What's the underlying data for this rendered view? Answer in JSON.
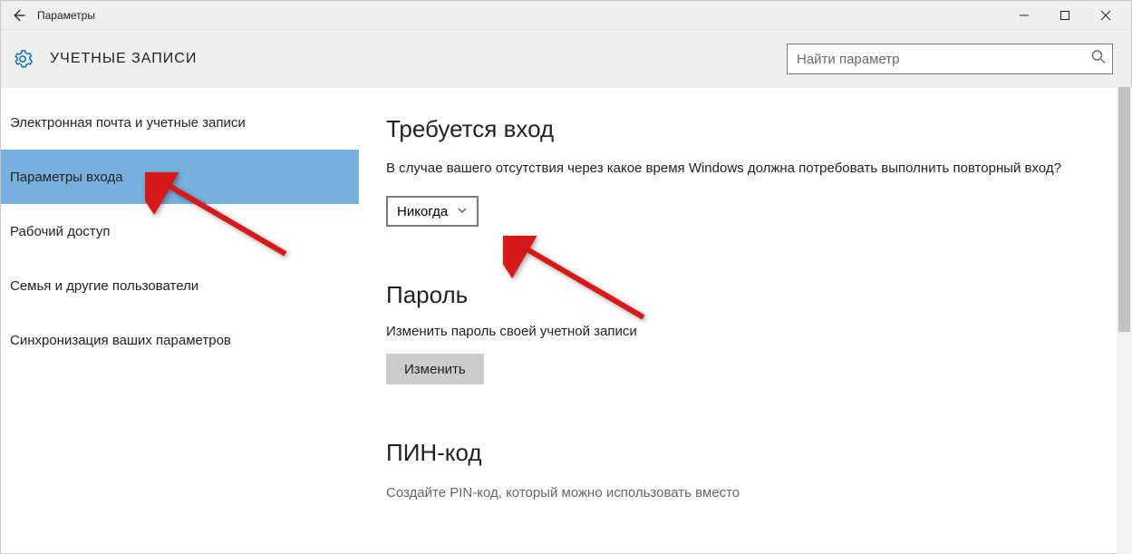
{
  "titlebar": {
    "title": "Параметры"
  },
  "header": {
    "category": "УЧЕТНЫЕ ЗАПИСИ",
    "search_placeholder": "Найти параметр"
  },
  "sidebar": {
    "items": [
      {
        "label": "Электронная почта и учетные записи",
        "selected": false
      },
      {
        "label": "Параметры входа",
        "selected": true
      },
      {
        "label": "Рабочий доступ",
        "selected": false
      },
      {
        "label": "Семья и другие пользователи",
        "selected": false
      },
      {
        "label": "Синхронизация ваших параметров",
        "selected": false
      }
    ]
  },
  "main": {
    "signin": {
      "heading": "Требуется вход",
      "desc": "В случае вашего отсутствия через какое время Windows должна потребовать выполнить повторный вход?",
      "select_value": "Никогда"
    },
    "password": {
      "heading": "Пароль",
      "desc": "Изменить пароль своей учетной записи",
      "button": "Изменить"
    },
    "pin": {
      "heading": "ПИН-код",
      "desc_cut": "Создайте PIN-код, который можно использовать вместо"
    }
  }
}
